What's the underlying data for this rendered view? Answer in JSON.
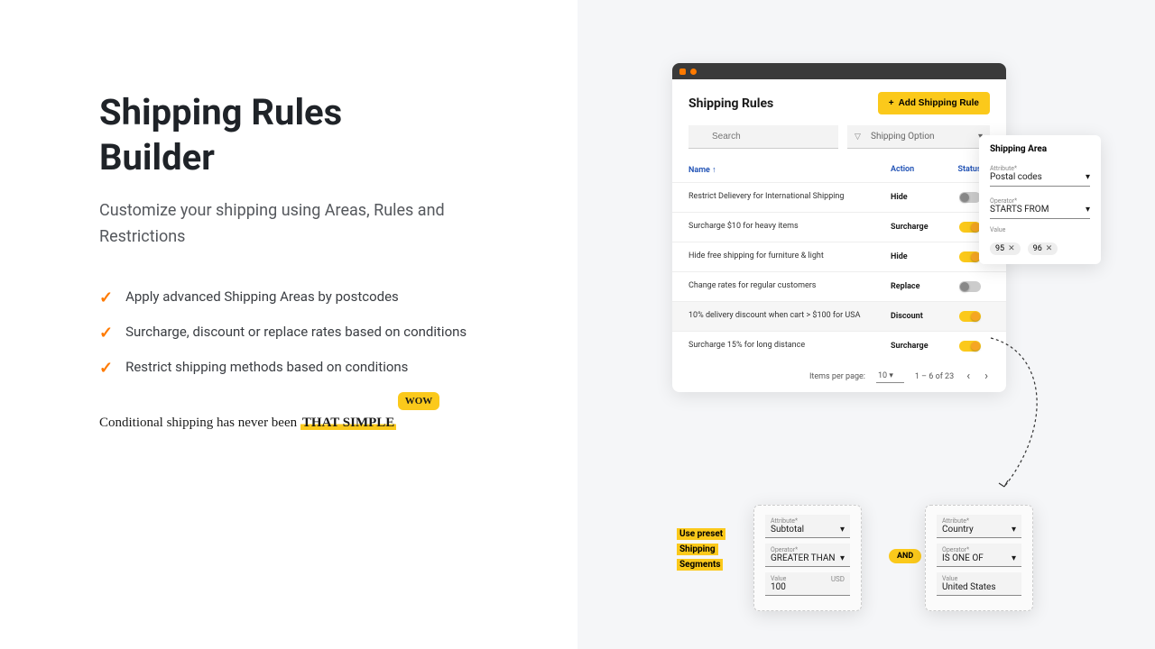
{
  "hero": {
    "title_l1": "Shipping Rules",
    "title_l2": "Builder",
    "subtitle": "Customize your shipping using Areas, Rules and Restrictions",
    "features": [
      "Apply advanced Shipping Areas by postcodes",
      "Surcharge, discount or replace rates based on conditions",
      "Restrict shipping methods based on conditions"
    ],
    "tagline_pre": "Conditional shipping has never been ",
    "tagline_hl": "THAT SIMPLE",
    "wow": "WOW"
  },
  "window": {
    "title": "Shipping Rules",
    "add_btn": "Add Shipping Rule",
    "search_ph": "Search",
    "filter_label": "Shipping Option",
    "col_name": "Name",
    "col_action": "Action",
    "col_status": "Status",
    "rows": [
      {
        "name": "Restrict Delievery for International Shipping",
        "action": "Hide",
        "on": false,
        "sel": false
      },
      {
        "name": "Surcharge $10 for heavy items",
        "action": "Surcharge",
        "on": true,
        "sel": false
      },
      {
        "name": "Hide free shipping for furniture & light",
        "action": "Hide",
        "on": true,
        "sel": false
      },
      {
        "name": "Change rates for regular customers",
        "action": "Replace",
        "on": false,
        "sel": false
      },
      {
        "name": "10% delivery discount when cart > $100 for USA",
        "action": "Discount",
        "on": true,
        "sel": true
      },
      {
        "name": "Surcharge 15% for long distance",
        "action": "Surcharge",
        "on": true,
        "sel": false
      }
    ],
    "items_per_page_label": "Items per page:",
    "items_per_page": "10",
    "range": "1 – 6 of 23"
  },
  "area_card": {
    "title": "Shipping Area",
    "attr_label": "Attribute*",
    "attr_value": "Postal codes",
    "op_label": "Operator*",
    "op_value": "STARTS FROM",
    "val_label": "Value",
    "chips": [
      "95",
      "96"
    ]
  },
  "seg1": {
    "attr_label": "Attribute*",
    "attr": "Subtotal",
    "op_label": "Operator*",
    "op": "GREATER THAN",
    "val_label": "Value",
    "val": "100",
    "unit": "USD"
  },
  "seg2": {
    "attr_label": "Attribute*",
    "attr": "Country",
    "op_label": "Operator*",
    "op": "IS ONE OF",
    "val_label": "Value",
    "val": "United States"
  },
  "and": "AND",
  "preset": {
    "l1": "Use preset",
    "l2": "Shipping",
    "l3": "Segments"
  }
}
